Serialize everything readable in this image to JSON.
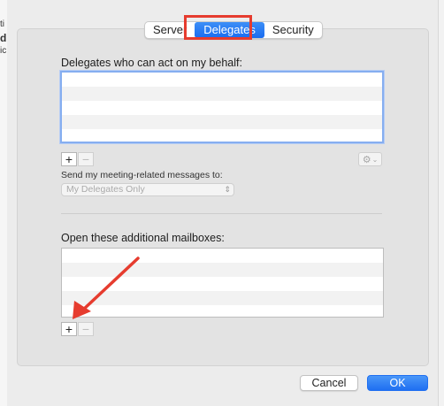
{
  "background": {
    "left_glyphs": [
      "ti",
      "d",
      "ic"
    ]
  },
  "tabs": {
    "items": [
      {
        "label": "Server"
      },
      {
        "label": "Delegates",
        "selected": true
      },
      {
        "label": "Security"
      }
    ]
  },
  "delegates": {
    "heading": "Delegates who can act on my behalf:",
    "add_label": "+",
    "remove_label": "−",
    "send_label": "Send my meeting-related messages to:",
    "send_selected": "My Delegates Only",
    "gear_icon": "gear-icon"
  },
  "mailboxes": {
    "heading": "Open these additional mailboxes:",
    "add_label": "+",
    "remove_label": "−"
  },
  "annotations": {
    "highlight_color": "#e63c2f",
    "arrow_color": "#e63c2f"
  },
  "footer": {
    "cancel_label": "Cancel",
    "ok_label": "OK"
  }
}
